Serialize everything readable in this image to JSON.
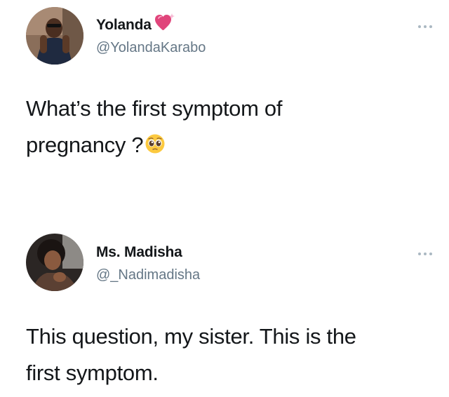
{
  "tweets": [
    {
      "display_name": "Yolanda",
      "name_emoji": "sparkling-heart-icon",
      "handle": "@YolandaKarabo",
      "text_line_1": "What’s the first symptom of",
      "text_line_2": "pregnancy ?",
      "text_emoji": "pleading-face-icon"
    },
    {
      "display_name": "Ms. Madisha",
      "handle": "@_Nadimadisha",
      "text_line_1": "This question, my sister. This is the",
      "text_line_2": "first symptom."
    }
  ],
  "colors": {
    "name": "#14171a",
    "handle": "#657786",
    "text": "#14171a",
    "more_dots": "#aab8c2",
    "heart": "#e0457b"
  },
  "icons": {
    "more": "more-icon"
  }
}
